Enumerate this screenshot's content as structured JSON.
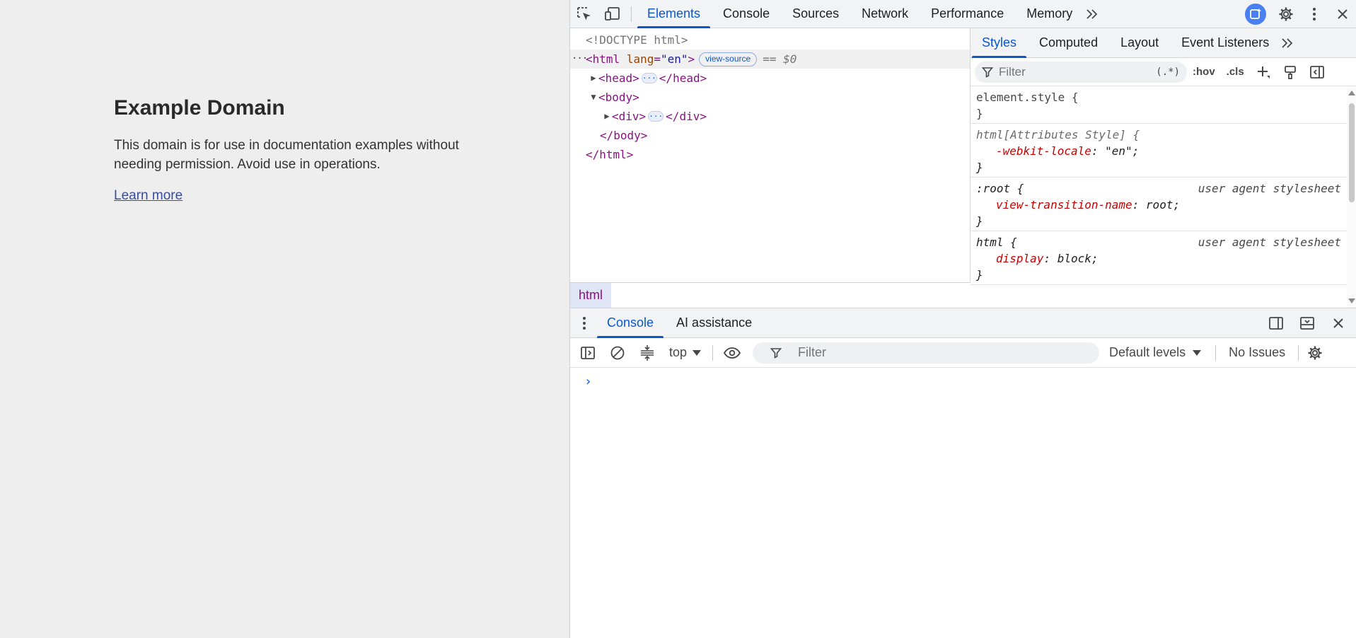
{
  "page": {
    "heading": "Example Domain",
    "paragraph": "This domain is for use in documentation examples without needing permission. Avoid use in operations.",
    "link": "Learn more"
  },
  "devtools": {
    "main_tabs": [
      "Elements",
      "Console",
      "Sources",
      "Network",
      "Performance",
      "Memory"
    ],
    "active_tab": "Elements",
    "more_tabs": "»",
    "dom": {
      "doctype": "<!DOCTYPE html>",
      "html_open_tag": "<html",
      "html_attr_name": "lang",
      "html_attr_value": "\"en\"",
      "html_close_bracket": ">",
      "view_source": "view-source",
      "selected_ref": "== $0",
      "head_open": "<head>",
      "head_close": "</head>",
      "body_open": "<body>",
      "div_open": "<div>",
      "div_close": "</div>",
      "body_close": "</body>",
      "html_close": "</html>",
      "ellipsis": "···"
    },
    "breadcrumb": "html",
    "styles_tabs": [
      "Styles",
      "Computed",
      "Layout",
      "Event Listeners"
    ],
    "styles_filter_placeholder": "Filter",
    "regex_toggle": "(.*)",
    "hov_button": ":hov",
    "cls_button": ".cls",
    "rules": [
      {
        "selector": "element.style {",
        "origin": "",
        "props": [],
        "close": "}"
      },
      {
        "selector": "html[Attributes Style] {",
        "origin": "",
        "props": [
          {
            "name": "-webkit-locale",
            "value": "\"en\";"
          }
        ],
        "close": "}"
      },
      {
        "selector": ":root {",
        "origin": "user agent stylesheet",
        "props": [
          {
            "name": "view-transition-name",
            "value": "root;"
          }
        ],
        "close": "}"
      },
      {
        "selector": "html {",
        "origin": "user agent stylesheet",
        "props": [
          {
            "name": "display",
            "value": "block;"
          }
        ],
        "close": "}"
      }
    ],
    "drawer_tabs": [
      "Console",
      "AI assistance"
    ],
    "active_drawer_tab": "Console",
    "console_context": "top",
    "console_filter_placeholder": "Filter",
    "log_levels": "Default levels",
    "issues": "No Issues",
    "prompt": "›"
  }
}
